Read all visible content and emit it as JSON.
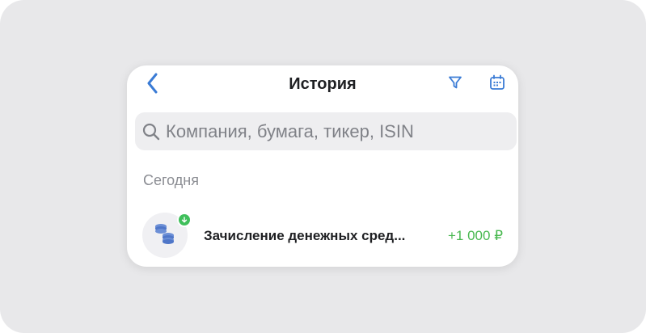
{
  "header": {
    "title": "История",
    "back_icon": "chevron-left-icon",
    "filter_icon": "filter-icon",
    "calendar_icon": "calendar-icon"
  },
  "search": {
    "placeholder": "Компания, бумага, тикер, ISIN",
    "value": ""
  },
  "sections": [
    {
      "label": "Сегодня",
      "items": [
        {
          "icon": "coins-icon",
          "badge_icon": "arrow-down-icon",
          "title": "Зачисление денежных сред...",
          "amount": "+1 000 ₽"
        }
      ]
    }
  ],
  "colors": {
    "accent": "#3a7bd5",
    "positive": "#48b84f",
    "badge": "#3fbf5b",
    "background": "#e8e8ea",
    "card": "#ffffff"
  }
}
